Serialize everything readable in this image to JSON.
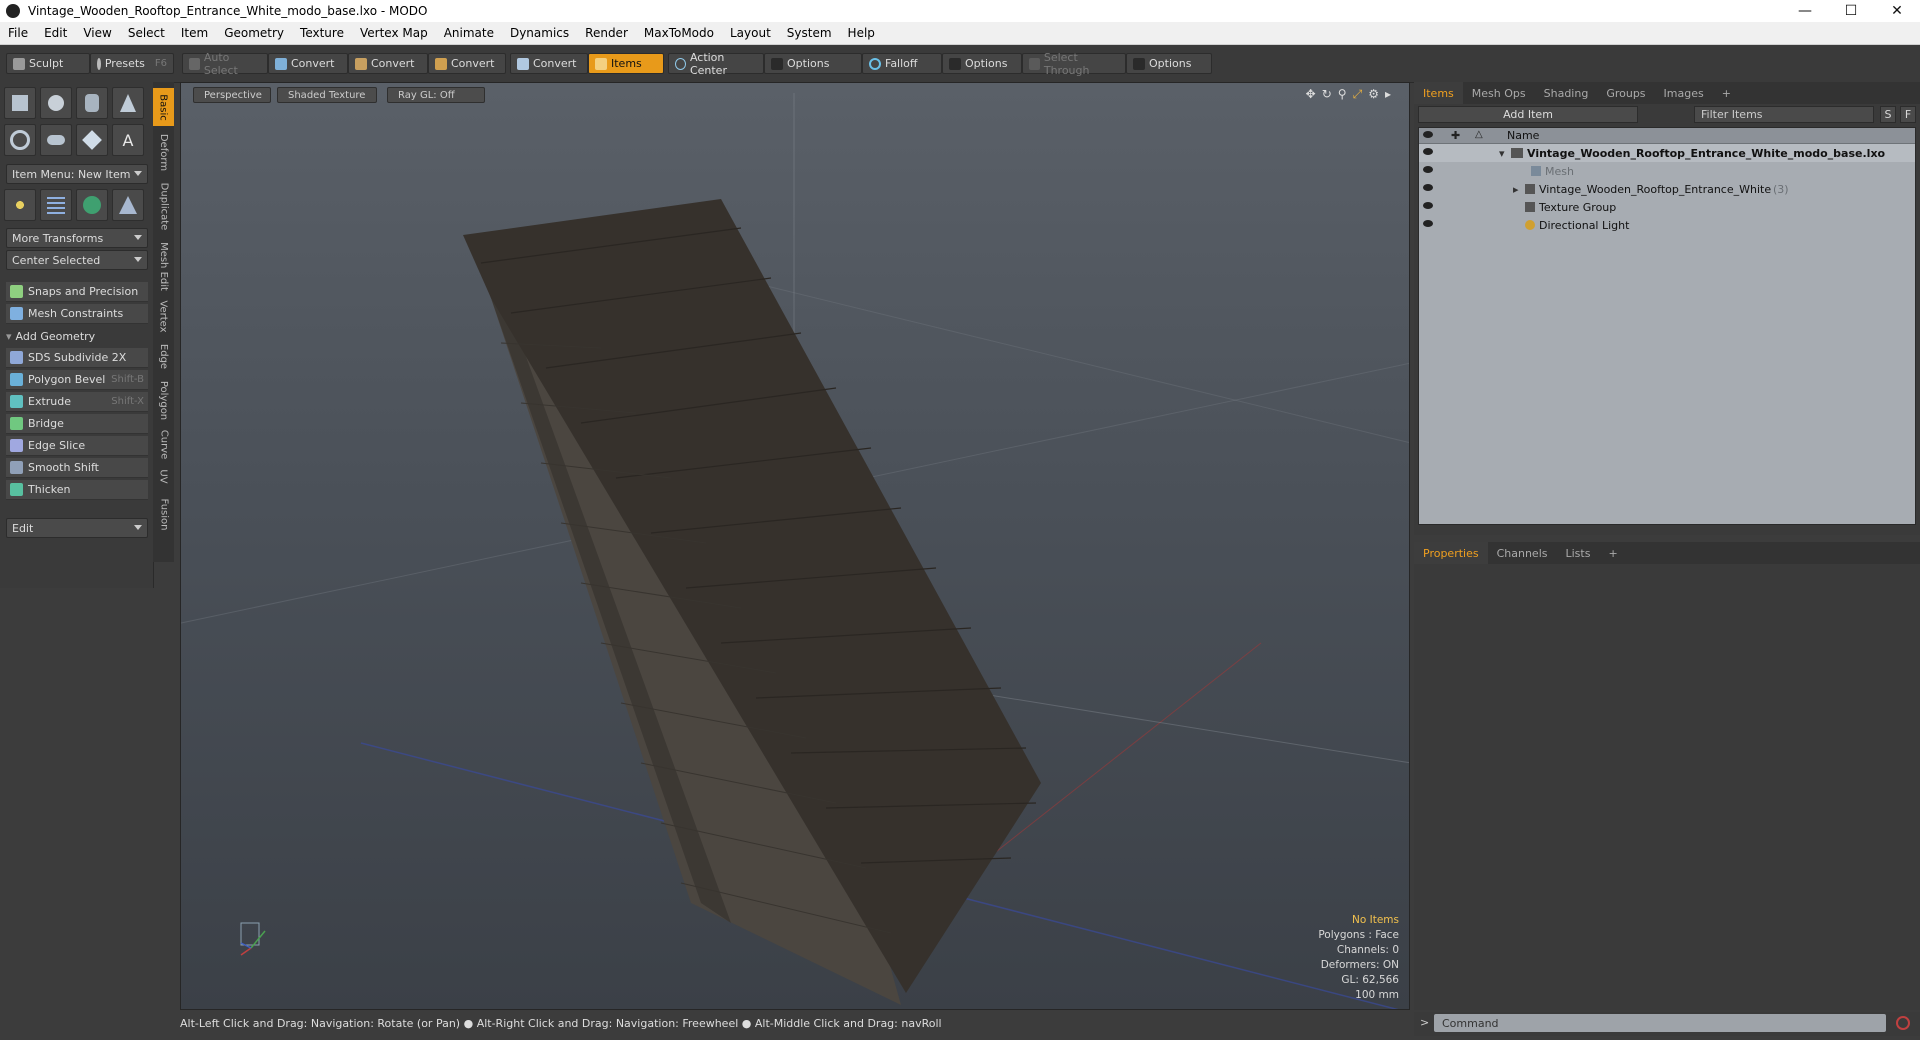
{
  "window": {
    "title": "Vintage_Wooden_Rooftop_Entrance_White_modo_base.lxo - MODO"
  },
  "menu": [
    "File",
    "Edit",
    "View",
    "Select",
    "Item",
    "Geometry",
    "Texture",
    "Vertex Map",
    "Animate",
    "Dynamics",
    "Render",
    "MaxToModo",
    "Layout",
    "System",
    "Help"
  ],
  "toolbar": {
    "sculpt": "Sculpt",
    "presets": "Presets",
    "presets_key": "F6",
    "auto_select": "Auto Select",
    "convert": "Convert",
    "items": "Items",
    "action_center": "Action Center",
    "options": "Options",
    "falloff": "Falloff",
    "select_through": "Select Through"
  },
  "left": {
    "item_menu": "Item Menu: New Item",
    "more_transforms": "More Transforms",
    "center_selected": "Center Selected",
    "snaps": "Snaps and Precision",
    "mesh_constraints": "Mesh Constraints",
    "add_geometry": "Add Geometry",
    "tools": [
      {
        "label": "SDS Subdivide 2X",
        "shortcut": ""
      },
      {
        "label": "Polygon Bevel",
        "shortcut": "Shift-B"
      },
      {
        "label": "Extrude",
        "shortcut": "Shift-X"
      },
      {
        "label": "Bridge",
        "shortcut": ""
      },
      {
        "label": "Edge Slice",
        "shortcut": ""
      },
      {
        "label": "Smooth Shift",
        "shortcut": ""
      },
      {
        "label": "Thicken",
        "shortcut": ""
      }
    ],
    "edit": "Edit",
    "vtabs": [
      "Basic",
      "Deform",
      "Duplicate",
      "Mesh Edit",
      "Vertex",
      "Edge",
      "Polygon",
      "Curve",
      "UV",
      "Fusion"
    ]
  },
  "viewport": {
    "perspective": "Perspective",
    "shaded": "Shaded Texture",
    "raygl": "Ray GL: Off",
    "hud": {
      "no_items": "No Items",
      "polygons": "Polygons : Face",
      "channels": "Channels: 0",
      "deformers": "Deformers: ON",
      "gl": "GL: 62,566",
      "scale": "100 mm"
    }
  },
  "status": "Alt-Left Click and Drag: Navigation: Rotate (or Pan) ● Alt-Right Click and Drag: Navigation: Freewheel ● Alt-Middle Click and Drag: navRoll",
  "items_panel": {
    "tabs": [
      "Items",
      "Mesh Ops",
      "Shading",
      "Groups",
      "Images",
      "+"
    ],
    "add_item": "Add Item",
    "filter": "Filter Items",
    "s": "S",
    "f": "F",
    "name_col": "Name",
    "rows": [
      {
        "label": "Vintage_Wooden_Rooftop_Entrance_White_modo_base.lxo",
        "bold": true
      },
      {
        "label": "Mesh",
        "dim": true
      },
      {
        "label": "Vintage_Wooden_Rooftop_Entrance_White",
        "count": "(3)"
      },
      {
        "label": "Texture Group"
      },
      {
        "label": "Directional Light"
      }
    ]
  },
  "properties_panel": {
    "tabs": [
      "Properties",
      "Channels",
      "Lists",
      "+"
    ]
  },
  "command": {
    "placeholder": "Command"
  },
  "colors": {
    "accent": "#e89a1a",
    "viewport_bg": "#4a5058"
  }
}
